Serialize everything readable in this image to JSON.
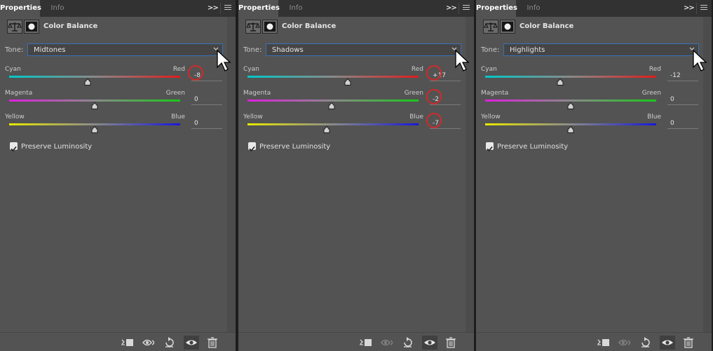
{
  "panels": [
    {
      "tabs": {
        "active": "Properties",
        "inactive": "Info"
      },
      "collapse_label": ">>",
      "header": {
        "title": "Color Balance"
      },
      "tone": {
        "label": "Tone:",
        "value": "Midtones"
      },
      "sliders": [
        {
          "left": "Cyan",
          "right": "Red",
          "value": "-8",
          "level": -8,
          "circled": true
        },
        {
          "left": "Magenta",
          "right": "Green",
          "value": "0",
          "level": 0,
          "circled": false
        },
        {
          "left": "Yellow",
          "right": "Blue",
          "value": "0",
          "level": 0,
          "circled": false
        }
      ],
      "preserve_luminosity": {
        "label": "Preserve Luminosity",
        "checked": true
      },
      "footer": {
        "previous_state_enabled": true
      }
    },
    {
      "tabs": {
        "active": "Properties",
        "inactive": "Info"
      },
      "collapse_label": ">>",
      "header": {
        "title": "Color Balance"
      },
      "tone": {
        "label": "Tone:",
        "value": "Shadows"
      },
      "sliders": [
        {
          "left": "Cyan",
          "right": "Red",
          "value": "+17",
          "level": 17,
          "circled": true
        },
        {
          "left": "Magenta",
          "right": "Green",
          "value": "-2",
          "level": -2,
          "circled": true
        },
        {
          "left": "Yellow",
          "right": "Blue",
          "value": "-7",
          "level": -7,
          "circled": true
        }
      ],
      "preserve_luminosity": {
        "label": "Preserve Luminosity",
        "checked": true
      },
      "footer": {
        "previous_state_enabled": false
      }
    },
    {
      "tabs": {
        "active": "Properties",
        "inactive": "Info"
      },
      "collapse_label": ">>",
      "header": {
        "title": "Color Balance"
      },
      "tone": {
        "label": "Tone:",
        "value": "Highlights"
      },
      "sliders": [
        {
          "left": "Cyan",
          "right": "Red",
          "value": "-12",
          "level": -12,
          "circled": false
        },
        {
          "left": "Magenta",
          "right": "Green",
          "value": "0",
          "level": 0,
          "circled": false
        },
        {
          "left": "Yellow",
          "right": "Blue",
          "value": "0",
          "level": 0,
          "circled": false
        }
      ],
      "preserve_luminosity": {
        "label": "Preserve Luminosity",
        "checked": true
      },
      "footer": {
        "previous_state_enabled": false
      }
    }
  ],
  "slider_gradients": [
    [
      "#00c8c8",
      "#e01c1c"
    ],
    [
      "#e01ee0",
      "#18c818"
    ],
    [
      "#e8e800",
      "#1818d8"
    ]
  ],
  "icons": {
    "header": [
      "scale-icon",
      "layer-mask-icon"
    ],
    "footer": [
      "clip-to-layer-icon",
      "view-previous-state-icon",
      "reset-icon",
      "visibility-eye-icon",
      "trash-icon"
    ],
    "tone_dropdown": "chevron-down-icon",
    "pointer": "mouse-cursor-icon"
  },
  "colors": {
    "panel_bg": "#535353",
    "tab_bar_bg": "#323232",
    "focus_border": "#3a6fb7",
    "annotation_circle": "#d12a2a"
  }
}
